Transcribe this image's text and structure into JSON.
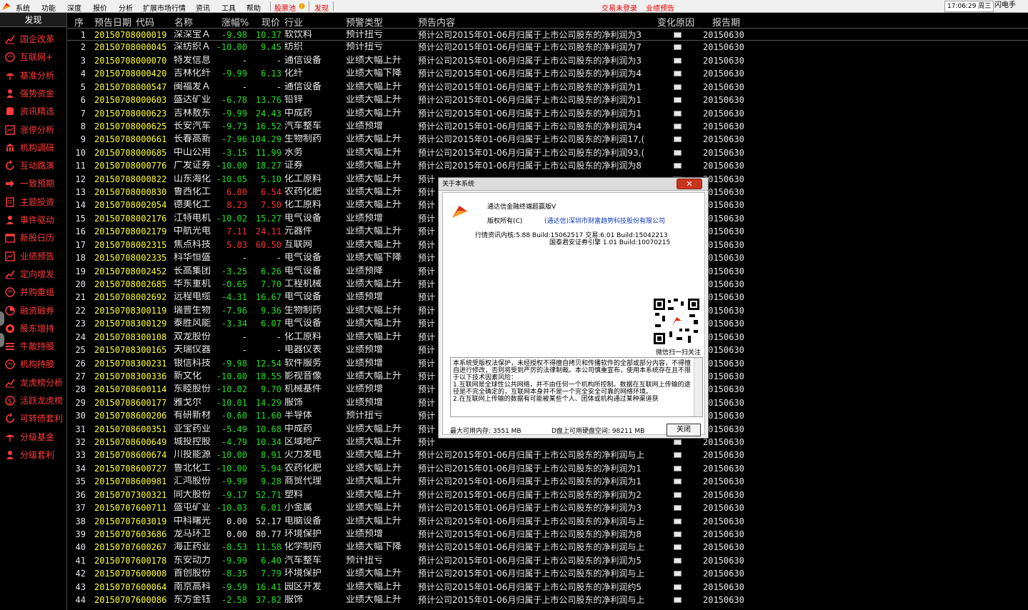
{
  "menubar": {
    "items": [
      "系统",
      "功能",
      "深度",
      "报价",
      "分析",
      "扩展市场行情",
      "资讯",
      "工具",
      "帮助"
    ],
    "stock_pool": "股票池",
    "discover": "发现",
    "trade_login": "交易未登录",
    "forecast": "业绩预告",
    "clock": "17:06:29 周三",
    "flash": "闪电手"
  },
  "sidebar": {
    "title": "发现",
    "items": [
      {
        "label": "国企改革",
        "icon": "line-chart-icon"
      },
      {
        "label": "互联网+",
        "icon": "globe-icon"
      },
      {
        "label": "基准分析",
        "icon": "umbrella-icon"
      },
      {
        "label": "强势资金",
        "icon": "person-icon"
      },
      {
        "label": "资讯精选",
        "icon": "database-icon"
      },
      {
        "label": "涨停分析",
        "icon": "chart-box-icon"
      },
      {
        "label": "机构调研",
        "icon": "building-icon"
      },
      {
        "label": "互动路演",
        "icon": "refresh-icon"
      },
      {
        "label": "一致预期",
        "icon": "arrow-icon"
      },
      {
        "label": "主题投资",
        "icon": "document-icon"
      },
      {
        "label": "事件驱动",
        "icon": "person-icon"
      },
      {
        "label": "新股日历",
        "icon": "calendar-icon"
      },
      {
        "label": "业绩预告",
        "icon": "chart-box-icon"
      },
      {
        "label": "定向增发",
        "icon": "line-chart-icon"
      },
      {
        "label": "并购重组",
        "icon": "globe-icon"
      },
      {
        "label": "融资融券",
        "icon": "pie-icon"
      },
      {
        "label": "股东增持",
        "icon": "coin-icon"
      },
      {
        "label": "牛散持股",
        "icon": "list-icon"
      },
      {
        "label": "机构持股",
        "icon": "globe-icon"
      },
      {
        "label": "龙虎榜分析",
        "icon": "line-chart-icon"
      },
      {
        "label": "活跃龙虎榜",
        "icon": "dollar-icon"
      },
      {
        "label": "可转债套利",
        "icon": "refresh-icon"
      },
      {
        "label": "分级基金",
        "icon": "umbrella-icon"
      },
      {
        "label": "分级套利",
        "icon": "person-icon"
      }
    ]
  },
  "table": {
    "headers": {
      "seq": "序",
      "date": "预告日期",
      "code": "代码",
      "name": "名称",
      "change": "涨幅%",
      "price": "现价",
      "industry": "行业",
      "type": "预警类型",
      "content": "预告内容",
      "reason": "变化原因",
      "period": "报告期"
    },
    "rows": [
      [
        "1",
        "20150708",
        "000019",
        "深深宝Ａ",
        "-9.98",
        "10.37",
        "软饮料",
        "预计扭亏",
        "预计公司2015年01-06月归属于上市公司股东的净利润为3",
        "20150630"
      ],
      [
        "2",
        "20150708",
        "000045",
        "深纺织Ａ",
        "-10.00",
        "9.45",
        "纺织",
        "预计扭亏",
        "预计公司2015年01-06月归属于上市公司股东的净利润为7",
        "20150630"
      ],
      [
        "3",
        "20150708",
        "000070",
        "特发信息",
        "-",
        "-",
        "通信设备",
        "业绩大幅上升",
        "预计公司2015年01-06月归属于上市公司股东的净利润为3",
        "20150630"
      ],
      [
        "4",
        "20150708",
        "000420",
        "吉林化纤",
        "-9.99",
        "6.13",
        "化纤",
        "业绩大幅下降",
        "预计公司2015年01-06月归属于上市公司股东的净利润为4",
        "20150630"
      ],
      [
        "5",
        "20150708",
        "000547",
        "闽福发Ａ",
        "-",
        "-",
        "通信设备",
        "业绩大幅上升",
        "预计公司2015年01-06月归属于上市公司股东的净利润为1",
        "20150630"
      ],
      [
        "6",
        "20150708",
        "000603",
        "盛达矿业",
        "-6.78",
        "13.76",
        "铅锌",
        "业绩大幅上升",
        "预计公司2015年01-06月归属于上市公司股东的净利润为1",
        "20150630"
      ],
      [
        "7",
        "20150708",
        "000623",
        "吉林敖东",
        "-9.99",
        "24.43",
        "中成药",
        "业绩大幅上升",
        "预计公司2015年01-06月归属于上市公司股东的净利润为1",
        "20150630"
      ],
      [
        "8",
        "20150708",
        "000625",
        "长安汽车",
        "-9.73",
        "16.52",
        "汽车整车",
        "业绩预增",
        "预计公司2015年01-06月归属于上市公司股东的净利润为4",
        "20150630"
      ],
      [
        "9",
        "20150708",
        "000661",
        "长春高新",
        "-7.96",
        "104.29",
        "生物制药",
        "业绩大幅上升",
        "预计公司2015年01-06月归属于上市公司股东的净利润17,(",
        "20150630"
      ],
      [
        "10",
        "20150708",
        "000685",
        "中山公用",
        "-3.15",
        "11.99",
        "水务",
        "业绩大幅上升",
        "预计公司2015年01-06月归属于上市公司股东的净利润93,(",
        "20150630"
      ],
      [
        "11",
        "20150708",
        "000776",
        "广发证券",
        "-10.00",
        "18.27",
        "证券",
        "业绩大幅上升",
        "预计公司2015年01-06月归属于上市公司股东的净利润为8",
        "20150630"
      ],
      [
        "12",
        "20150708",
        "000822",
        "山东海化",
        "-10.05",
        "5.10",
        "化工原料",
        "业绩大幅上升",
        "预计",
        "20150630"
      ],
      [
        "13",
        "20150708",
        "000830",
        "鲁西化工",
        "6.00",
        "6.54",
        "农药化肥",
        "业绩大幅上升",
        "预计",
        "20150630"
      ],
      [
        "14",
        "20150708",
        "002054",
        "德美化工",
        "8.23",
        "7.50",
        "化工原料",
        "业绩大幅上升",
        "预计",
        "20150630"
      ],
      [
        "15",
        "20150708",
        "002176",
        "江特电机",
        "-10.02",
        "15.27",
        "电气设备",
        "业绩预增",
        "预计",
        "20150630"
      ],
      [
        "16",
        "20150708",
        "002179",
        "中航光电",
        "7.11",
        "24.11",
        "元器件",
        "业绩大幅上升",
        "预计",
        "20150630"
      ],
      [
        "17",
        "20150708",
        "002315",
        "焦点科技",
        "5.03",
        "60.50",
        "互联网",
        "业绩大幅上升",
        "预计",
        "20150630"
      ],
      [
        "18",
        "20150708",
        "002335",
        "科华恒盛",
        "-",
        "-",
        "电气设备",
        "业绩大幅下降",
        "预计",
        "20150630"
      ],
      [
        "19",
        "20150708",
        "002452",
        "长高集团",
        "-3.25",
        "6.26",
        "电气设备",
        "业绩预降",
        "预计",
        "20150630"
      ],
      [
        "20",
        "20150708",
        "002685",
        "华东重机",
        "-0.65",
        "7.70",
        "工程机械",
        "业绩大幅上升",
        "预计",
        "20150630"
      ],
      [
        "21",
        "20150708",
        "002692",
        "远程电缆",
        "-4.31",
        "16.67",
        "电气设备",
        "业绩预增",
        "预计",
        "20150630"
      ],
      [
        "22",
        "20150708",
        "300119",
        "瑞普生物",
        "-7.96",
        "9.36",
        "生物制药",
        "业绩大幅上升",
        "预计",
        "20150630"
      ],
      [
        "23",
        "20150708",
        "300129",
        "泰胜风能",
        "-3.34",
        "6.07",
        "电气设备",
        "业绩大幅上升",
        "预计",
        "20150630"
      ],
      [
        "24",
        "20150708",
        "300108",
        "双龙股份",
        "-",
        "-",
        "化工原料",
        "业绩大幅上升",
        "预计",
        "20150630"
      ],
      [
        "25",
        "20150708",
        "300165",
        "天瑞仪器",
        "-",
        "-",
        "电器仪表",
        "业绩预增",
        "预计",
        "20150630"
      ],
      [
        "26",
        "20150708",
        "300231",
        "银信科技",
        "-9.98",
        "12.54",
        "软件服务",
        "业绩预增",
        "预计",
        "20150630"
      ],
      [
        "27",
        "20150708",
        "300336",
        "新文化",
        "-10.00",
        "18.55",
        "影视音像",
        "业绩大幅上升",
        "预计",
        "20150630"
      ],
      [
        "28",
        "20150708",
        "600114",
        "东睦股份",
        "-10.02",
        "9.70",
        "机械基件",
        "业绩预增",
        "预计",
        "20150630"
      ],
      [
        "29",
        "20150708",
        "600177",
        "雅戈尔",
        "-10.01",
        "14.29",
        "服饰",
        "业绩预增",
        "预计",
        "20150630"
      ],
      [
        "30",
        "20150708",
        "600206",
        "有研新材",
        "-0.60",
        "11.60",
        "半导体",
        "预计扭亏",
        "预计",
        "20150630"
      ],
      [
        "31",
        "20150708",
        "600351",
        "亚宝药业",
        "-5.49",
        "10.68",
        "中成药",
        "业绩大幅上升",
        "预计",
        "20150630"
      ],
      [
        "32",
        "20150708",
        "600649",
        "城投控股",
        "-4.79",
        "10.34",
        "区域地产",
        "业绩大幅上升",
        "预计",
        "20150630"
      ],
      [
        "33",
        "20150708",
        "600674",
        "川投能源",
        "-10.00",
        "8.91",
        "火力发电",
        "业绩大幅上升",
        "预计公司2015年01-06月归属于上市公司股东的净利润与上",
        "20150630"
      ],
      [
        "34",
        "20150708",
        "600727",
        "鲁北化工",
        "-10.00",
        "5.94",
        "农药化肥",
        "业绩大幅上升",
        "预计公司2015年01-06月归属于上市公司股东的净利润为1",
        "20150630"
      ],
      [
        "35",
        "20150708",
        "600981",
        "汇鸿股份",
        "-9.99",
        "9.28",
        "商贸代理",
        "业绩大幅上升",
        "预计公司2015年01-06月归属于上市公司股东的净利润为1",
        "20150630"
      ],
      [
        "36",
        "20150707",
        "300321",
        "同大股份",
        "-9.17",
        "52.71",
        "塑料",
        "业绩大幅上升",
        "预计公司2015年01-06月归属于上市公司股东的净利润为2",
        "20150630"
      ],
      [
        "37",
        "20150707",
        "600711",
        "盛屯矿业",
        "-10.03",
        "6.01",
        "小金属",
        "业绩大幅上升",
        "预计公司2015年01-06月归属于上市公司股东的净利润为3",
        "20150630"
      ],
      [
        "38",
        "20150707",
        "603019",
        "中科曙光",
        "0.00",
        "52.17",
        "电脑设备",
        "业绩大幅上升",
        "预计公司2015年01-06月归属于上市公司股东的净利润与上",
        "20150630"
      ],
      [
        "39",
        "20150707",
        "603686",
        "龙马环卫",
        "0.00",
        "80.77",
        "环境保护",
        "业绩预增",
        "预计公司2015年01-06月归属于上市公司股东的净利润为8",
        "20150630"
      ],
      [
        "40",
        "20150707",
        "600267",
        "海正药业",
        "-8.53",
        "11.58",
        "化学制药",
        "业绩大幅下降",
        "预计公司2015年01-06月归属于上市公司股东的净利润与上",
        "20150630"
      ],
      [
        "41",
        "20150707",
        "600178",
        "东安动力",
        "-9.99",
        "6.40",
        "汽车整车",
        "预计扭亏",
        "预计公司2015年01-06月归属于上市公司股东的净利润为5",
        "20150630"
      ],
      [
        "42",
        "20150707",
        "600008",
        "首创股份",
        "-8.35",
        "7.79",
        "环境保护",
        "业绩大幅上升",
        "预计公司2015年01-06月归属于上市公司股东的净利润与上",
        "20150630"
      ],
      [
        "43",
        "20150707",
        "600064",
        "南京高科",
        "-9.59",
        "16.41",
        "园区开发",
        "业绩大幅上升",
        "预计公司2015年01-06月归属于上市公司股东的净利润约5",
        "20150630"
      ],
      [
        "44",
        "20150707",
        "600086",
        "东方金钰",
        "-2.58",
        "37.82",
        "服饰",
        "业绩大幅上升",
        "预计公司2015年01-06月归属于上市公司股东的净利润与上",
        "20150630"
      ]
    ]
  },
  "dialog": {
    "title": "关于本系统",
    "product": "通达信金融终端超赢版V",
    "copyright": "版权所有(C)",
    "company": "(通达信)深圳市财富趋势科技股份有限公司",
    "versions": "行情资讯内核:5.88 Build:15062517 交易:6.01 Build:15042213",
    "engine": "国泰君安证券引擎 1.01 Build:10070215",
    "qr_caption": "微信扫一扫关注",
    "notice": "本系统受版权法保护，未经授权不得擅自拷贝和传播软件的全部或部分内容，不得擅自进行修改，否则将受到严厉的法律制裁。本公司慎重宣布，使用本系统存在且不限于以下技术因素风险：\n1.互联网是全球性公共网络，并不由任何一个机构所控制。数据在互联网上传输的途径是不完全确定的，互联网本身并不是一个完全安全可靠的网络环境。\n2.在互联网上传输的数据有可能被某些个人、团体或机构通过某种渠道获",
    "memory": "最大可用内存: 3551 MB",
    "disk": "D盘上可用硬盘空间: 98211 MB",
    "close": "关闭"
  },
  "colors": {
    "up": "#ff3030",
    "down": "#20e020",
    "date": "#ffff30",
    "sidebar_text": "#ff3b3b",
    "dialog_close": "#c7351f"
  }
}
